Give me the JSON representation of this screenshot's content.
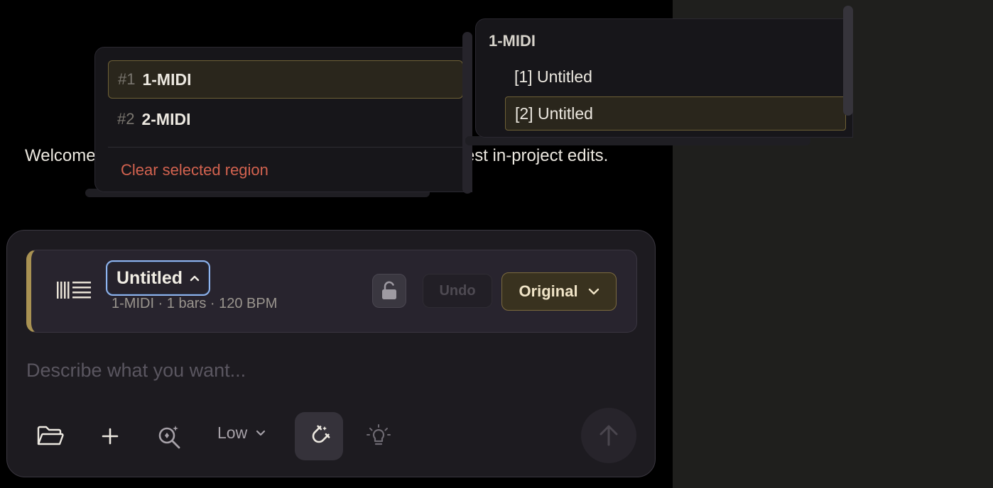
{
  "chat": {
    "welcome": "Welcome. Ask about your music, theory questions, or request in-project edits."
  },
  "track_card": {
    "title": "Untitled",
    "meta": "1-MIDI · 1 bars · 120 BPM",
    "undo_label": "Undo",
    "version_label": "Original",
    "accent": "#a99253"
  },
  "composer": {
    "placeholder": "Describe what you want...",
    "level_label": "Low"
  },
  "track_menu": {
    "items": [
      {
        "num": "#1",
        "name": "1-MIDI",
        "selected": true
      },
      {
        "num": "#2",
        "name": "2-MIDI",
        "selected": false
      }
    ],
    "clear_label": "Clear selected region"
  },
  "region_menu": {
    "track_name": "1-MIDI",
    "items": [
      {
        "label": "[1] Untitled",
        "selected": false
      },
      {
        "label": "[2] Untitled",
        "selected": true
      }
    ]
  },
  "icons": {
    "track": "midi-track-icon",
    "title_chevron": "chevron-up-icon",
    "lock": "unlock-icon",
    "version_chevron": "chevron-down-icon",
    "folder": "folder-open-icon",
    "add": "plus-icon",
    "zoom": "zoom-sparkle-icon",
    "level_chevron": "chevron-down-icon",
    "snap": "magnet-icon",
    "idea": "lightbulb-icon",
    "send": "arrow-up-icon"
  },
  "colors": {
    "selected_border": "#6e6036",
    "clear_text": "#d2624f",
    "focus_ring": "#8fb4ee"
  }
}
